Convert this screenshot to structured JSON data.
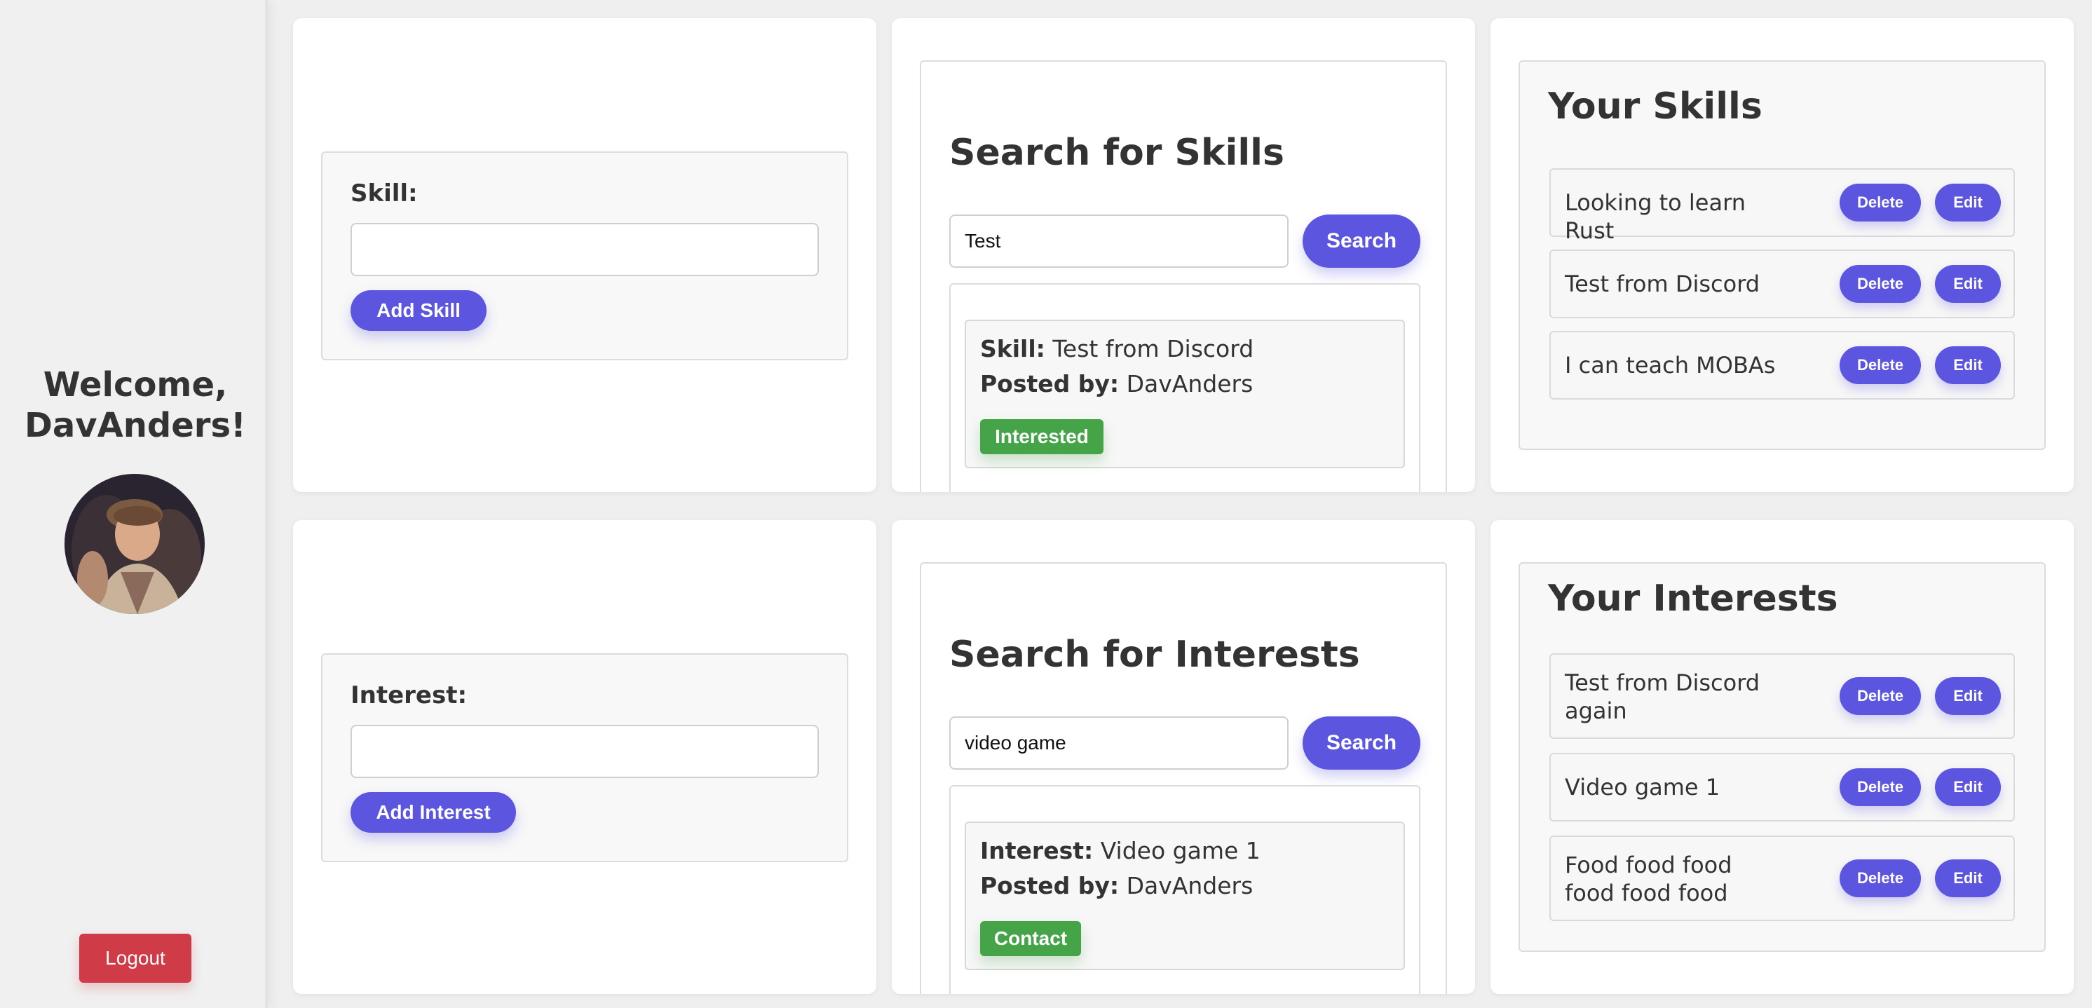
{
  "sidebar": {
    "welcome": "Welcome, DavAnders!",
    "logout_label": "Logout"
  },
  "add_skill": {
    "label": "Skill:",
    "input_value": "",
    "button_label": "Add Skill"
  },
  "search_skills": {
    "title": "Search for Skills",
    "query": "Test",
    "button_label": "Search",
    "result": {
      "kind_label": "Skill:",
      "value": "Test from Discord",
      "posted_by_label": "Posted by:",
      "posted_by": "DavAnders",
      "action_label": "Interested"
    }
  },
  "your_skills": {
    "title": "Your Skills",
    "delete_label": "Delete",
    "edit_label": "Edit",
    "items": [
      {
        "text": "Looking to learn Rust"
      },
      {
        "text": "Test from Discord"
      },
      {
        "text": "I can teach MOBAs"
      }
    ]
  },
  "add_interest": {
    "label": "Interest:",
    "input_value": "",
    "button_label": "Add Interest"
  },
  "search_interests": {
    "title": "Search for Interests",
    "query": "video game",
    "button_label": "Search",
    "result": {
      "kind_label": "Interest:",
      "value": "Video game 1",
      "posted_by_label": "Posted by:",
      "posted_by": "DavAnders",
      "action_label": "Contact"
    }
  },
  "your_interests": {
    "title": "Your Interests",
    "delete_label": "Delete",
    "edit_label": "Edit",
    "items": [
      {
        "text": "Test from Discord again"
      },
      {
        "text": "Video game 1"
      },
      {
        "text": "Food food food food food food"
      }
    ]
  },
  "colors": {
    "primary": "#5b55e0",
    "success": "#45a447",
    "danger": "#cf3b47",
    "background": "#efefef"
  }
}
